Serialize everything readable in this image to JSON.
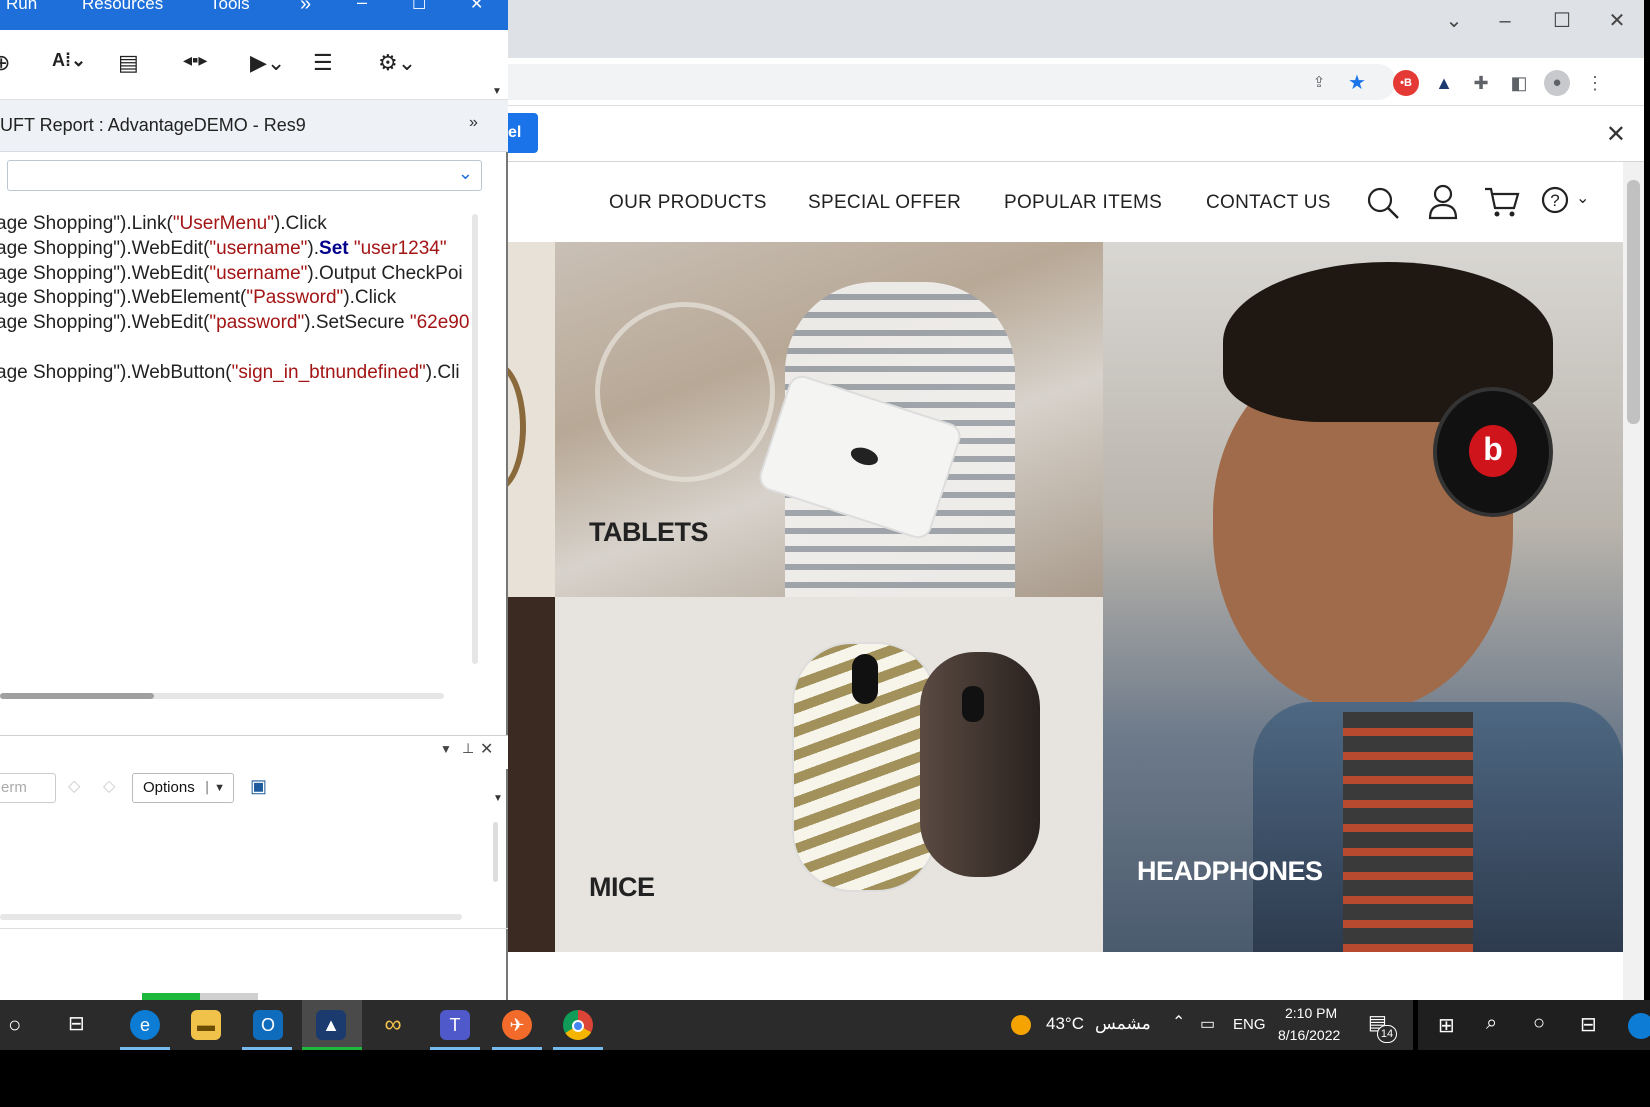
{
  "uft": {
    "menu": [
      "Run",
      "Resources",
      "Tools"
    ],
    "more": "»",
    "report_title": "UFT Report : AdvantageDEMO - Res9",
    "code_lines": [
      {
        "a": "age Shopping\").Link(",
        "s": "\"UserMenu\"",
        "b": ").Click",
        "k": "",
        "t": ""
      },
      {
        "a": "age Shopping\").WebEdit(",
        "s": "\"username\"",
        "b": ").",
        "k": "Set",
        "t": " \"user1234\""
      },
      {
        "a": "age Shopping\").WebEdit(",
        "s": "\"username\"",
        "b": ").Output CheckPoi",
        "k": "",
        "t": ""
      },
      {
        "a": "age Shopping\").WebElement(",
        "s": "\"Password\"",
        "b": ").Click",
        "k": "",
        "t": ""
      },
      {
        "a": "age Shopping\").WebEdit(",
        "s": "\"password\"",
        "b": ").SetSecure ",
        "k": "",
        "t": "\"62e90"
      },
      {
        "a": "",
        "s": "",
        "b": "",
        "k": "",
        "t": ""
      },
      {
        "a": "age Shopping\").WebButton(",
        "s": "\"sign_in_btnundefined\"",
        "b": ").Cli",
        "k": "",
        "t": ""
      }
    ],
    "search_placeholder": "erm",
    "options_label": "Options"
  },
  "browser": {
    "infobar_button": "el",
    "nav": [
      "OUR PRODUCTS",
      "SPECIAL OFFER",
      "POPULAR ITEMS",
      "CONTACT US"
    ],
    "tiles": {
      "tablets": "TABLETS",
      "mice": "MICE",
      "headphones": "HEADPHONES"
    }
  },
  "taskbar": {
    "weather_temp": "43°C",
    "weather_text": "مشمس",
    "lang": "ENG",
    "time": "2:10 PM",
    "date": "8/16/2022",
    "notifications": "14"
  },
  "colors": {
    "uft_titlebar": "#1e6fd9",
    "chrome_blue": "#1a73e8",
    "taskbar": "#2b2b2b"
  }
}
